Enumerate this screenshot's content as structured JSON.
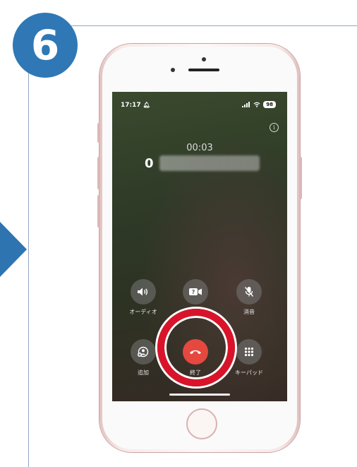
{
  "step_badge": {
    "number": "6"
  },
  "status_bar": {
    "time": "17:17",
    "battery": "98"
  },
  "call": {
    "timer": "00:03",
    "number_visible": "0"
  },
  "controls": {
    "audio_label": "オーディオ",
    "mute_label": "消音",
    "add_label": "追加",
    "end_label": "終了",
    "keypad_label": "キーパッド",
    "facetime_label": ""
  },
  "colors": {
    "step_blue": "#2f78b5",
    "end_call_red": "#e5483f",
    "highlight_red": "#d9142a"
  },
  "icons": {
    "speaker": "speaker-icon",
    "facetime": "facetime-icon",
    "mute": "mic-slash-icon",
    "add": "add-call-icon",
    "end": "phone-hangup-icon",
    "keypad": "keypad-icon",
    "info": "info-icon",
    "bell": "bell-icon"
  }
}
